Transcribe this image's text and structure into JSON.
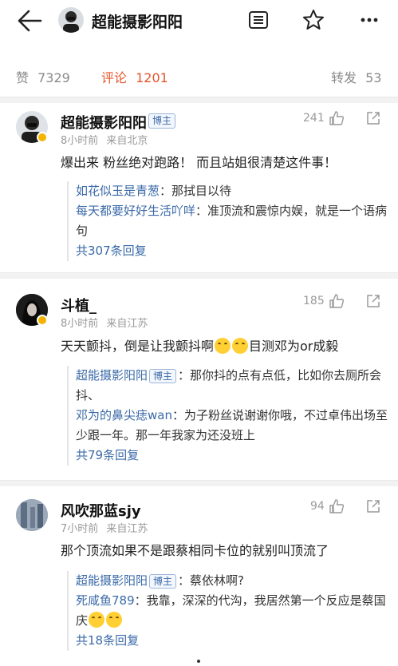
{
  "header": {
    "title": "超能摄影阳阳"
  },
  "stats": {
    "likes_label": "赞",
    "likes": "7329",
    "comments_label": "评论",
    "comments": "1201",
    "reposts_label": "转发",
    "reposts": "53"
  },
  "comments": [
    {
      "name": "超能摄影阳阳",
      "tag": "博主",
      "time": "8小时前",
      "location": "来自北京",
      "likes": "241",
      "text": "爆出来 粉丝绝对跑路！ 而且站姐很清楚这件事！",
      "replies": [
        {
          "who": "如花似玉是青葱",
          "text": "：那拭目以待"
        },
        {
          "who": "每天都要好好生活吖咩",
          "text": "：准顶流和震惊内娱，就是一个语病句"
        }
      ],
      "more": "共307条回复"
    },
    {
      "name": "斗植_",
      "time": "8小时前",
      "location": "来自江苏",
      "likes": "185",
      "text_before": "天天颤抖，倒是让我颤抖啊",
      "text_after": "目测邓为or成毅",
      "replies": [
        {
          "who": "超能摄影阳阳",
          "tag": "博主",
          "text": "：那你抖的点有点低，比如你去厕所会抖、"
        },
        {
          "who": "邓为的鼻尖痣wan",
          "text": "：为子粉丝说谢谢你哦，不过卓伟出场至少跟一年。那一年我家为还没班上"
        }
      ],
      "more": "共79条回复"
    },
    {
      "name": "风吹那蓝sjy",
      "time": "7小时前",
      "location": "来自江苏",
      "likes": "94",
      "text": "那个顶流如果不是跟蔡相同卡位的就别叫顶流了",
      "replies": [
        {
          "who": "超能摄影阳阳",
          "tag": "博主",
          "text": "：蔡依林啊?"
        },
        {
          "who": "死咸鱼789",
          "text": "：我靠，深深的代沟，我居然第一个反应是蔡国庆"
        }
      ],
      "more": "共18条回复"
    }
  ],
  "colors": {
    "accent": "#e5542b",
    "link": "#3b6aa8",
    "badge": "#f5b400"
  },
  "icons": [
    "back-arrow-icon",
    "list-icon",
    "star-icon",
    "more-icon",
    "like-icon",
    "share-icon",
    "verified-badge-icon",
    "emoji-icon"
  ]
}
